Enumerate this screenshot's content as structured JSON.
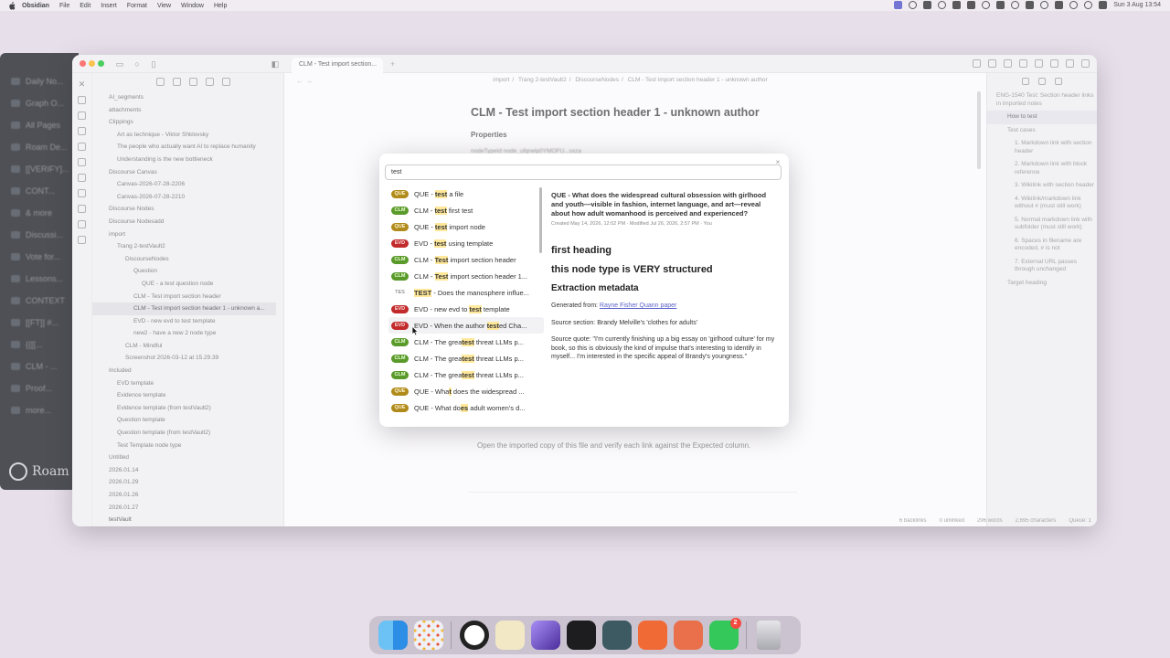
{
  "menubar": {
    "app": "Obsidian",
    "items": [
      "File",
      "Edit",
      "Insert",
      "Format",
      "View",
      "Window",
      "Help"
    ],
    "clock": "Sun 3 Aug  13:54"
  },
  "roam": {
    "items": [
      "Daily No...",
      "Graph O...",
      "All Pages",
      "Roam De...",
      "[[VERIFY]...",
      "CONT...",
      "& more",
      "Discussi...",
      "Vote for...",
      "Lessons...",
      "CONTEXT",
      "[[FT]] #...",
      "{{[[...",
      "CLM - ...",
      "Proof...",
      "more..."
    ],
    "logo": "Roam"
  },
  "window": {
    "tab_title": "CLM - Test import section...",
    "breadcrumb": [
      "import",
      "Trang 2-testVault2",
      "DiscourseNodes",
      "CLM - Test import section header 1 - unknown author"
    ],
    "title": "CLM - Test import section header 1 - unknown author",
    "properties_label": "Properties",
    "prop_row": "nodeTypeId     node_ufqnelp0YMOFU...sxza",
    "body_line": "Open the imported copy of this file and verify each link against the Expected column.",
    "vault_name": "testVault",
    "status": [
      "6 backlinks",
      "0 unlinked",
      "296 words",
      "2,695 characters",
      "Queue: 1"
    ]
  },
  "tree": [
    {
      "label": "AI_segments",
      "indent": 0
    },
    {
      "label": "attachments",
      "indent": 0
    },
    {
      "label": "Clippings",
      "indent": 0
    },
    {
      "label": "Art as technique - Viktor Shklovsky",
      "indent": 1
    },
    {
      "label": "The people who actually want AI to replace humanity",
      "indent": 1
    },
    {
      "label": "Understanding is the new bottleneck",
      "indent": 1
    },
    {
      "label": "Discourse Canvas",
      "indent": 0
    },
    {
      "label": "Canvas-2026-07-28-2206",
      "indent": 1
    },
    {
      "label": "Canvas-2026-07-28-2210",
      "indent": 1
    },
    {
      "label": "Discourse Nodes",
      "indent": 0
    },
    {
      "label": "Discourse Nodesadd",
      "indent": 0
    },
    {
      "label": "import",
      "indent": 0
    },
    {
      "label": "Trang 2-testVault2",
      "indent": 1
    },
    {
      "label": "DiscourseNodes",
      "indent": 2
    },
    {
      "label": "Question",
      "indent": 3
    },
    {
      "label": "QUE - a test question node",
      "indent": 4
    },
    {
      "label": "CLM - Test import section header",
      "indent": 3
    },
    {
      "label": "CLM - Test import section header 1 - unknown a...",
      "indent": 3,
      "selected": true
    },
    {
      "label": "EVD - new evd to test template",
      "indent": 3
    },
    {
      "label": "new2 - have a new 2 node type",
      "indent": 3
    },
    {
      "label": "CLM - Mindful",
      "indent": 2
    },
    {
      "label": "Screenshot 2026-03-12 at 15.29.39",
      "indent": 2
    },
    {
      "label": "Included",
      "indent": 0
    },
    {
      "label": "EVD template",
      "indent": 1
    },
    {
      "label": "Evidence template",
      "indent": 1
    },
    {
      "label": "Evidence template (from testVault2)",
      "indent": 1
    },
    {
      "label": "Question template",
      "indent": 1
    },
    {
      "label": "Question template (from testVault2)",
      "indent": 1
    },
    {
      "label": "Test Template node type",
      "indent": 1
    },
    {
      "label": "Untitled",
      "indent": 0
    },
    {
      "label": "2026.01.14",
      "indent": 0
    },
    {
      "label": "2026.01.29",
      "indent": 0
    },
    {
      "label": "2026.01.26",
      "indent": 0
    },
    {
      "label": "2026.01.27",
      "indent": 0
    }
  ],
  "outline": [
    {
      "label": "ENG-1540 Test: Section header links in imported notes",
      "level": 1
    },
    {
      "label": "How to test",
      "level": 2,
      "current": true
    },
    {
      "label": "Test cases",
      "level": 2
    },
    {
      "label": "1. Markdown link with section header",
      "level": 3
    },
    {
      "label": "2. Markdown link with block reference",
      "level": 3
    },
    {
      "label": "3. Wikilink with section header",
      "level": 3
    },
    {
      "label": "4. Wikilink/markdown link without # (must still work)",
      "level": 3
    },
    {
      "label": "5. Normal markdown link with subfolder (must still work)",
      "level": 3
    },
    {
      "label": "6. Spaces in filename are encoded, # is not",
      "level": 3
    },
    {
      "label": "7. External URL passes through unchanged",
      "level": 3
    },
    {
      "label": "Target heading",
      "level": 2
    }
  ],
  "modal": {
    "query": "test",
    "close": "×",
    "results": [
      {
        "badge": "QUE",
        "pre": "QUE - ",
        "hit": "test",
        "post": " a file"
      },
      {
        "badge": "CLM",
        "pre": "CLM - ",
        "hit": "test",
        "post": " first test"
      },
      {
        "badge": "QUE",
        "pre": "QUE - ",
        "hit": "test",
        "post": " import node"
      },
      {
        "badge": "EVD",
        "pre": "EVD - ",
        "hit": "test",
        "post": " using template"
      },
      {
        "badge": "CLM",
        "pre": "CLM - ",
        "hit": "Test",
        "post": " import section header"
      },
      {
        "badge": "CLM",
        "pre": "CLM - ",
        "hit": "Test",
        "post": " import section header 1..."
      },
      {
        "badge": "TES",
        "pre": "",
        "hit": "TEST",
        "post": " - Does the manosphere influe..."
      },
      {
        "badge": "EVD",
        "pre": "EVD - new evd to ",
        "hit": "test",
        "post": " template"
      },
      {
        "badge": "EVD",
        "pre": "EVD - When the author ",
        "hit": "test",
        "post": "ed Cha..."
      },
      {
        "badge": "CLM",
        "pre": "CLM - The grea",
        "hit": "test",
        "post": " threat LLMs p..."
      },
      {
        "badge": "CLM",
        "pre": "CLM - The grea",
        "hit": "test",
        "post": " threat LLMs p..."
      },
      {
        "badge": "CLM",
        "pre": "CLM - The grea",
        "hit": "test",
        "post": " threat LLMs p..."
      },
      {
        "badge": "QUE",
        "pre": "QUE - Wha",
        "hit": "t",
        "post": " does the widespread ..."
      },
      {
        "badge": "QUE",
        "pre": "QUE - What do",
        "hit": "es",
        "post": " adult women's d..."
      }
    ],
    "preview": {
      "title": "QUE - What does the widespread cultural obsession with girlhood and youth—visible in fashion, internet language, and art—reveal about how adult womanhood is perceived and experienced?",
      "meta": "Created May 14, 2026, 12:02 PM · Modified Jul 26, 2026, 2:57 PM · You",
      "h1": "first heading",
      "h2": "this node type is VERY structured",
      "h3": "Extraction metadata",
      "generated_label": "Generated from: ",
      "generated_link": "Rayne Fisher Quann paper",
      "source_section": "Source section: Brandy Melville's 'clothes for adults'",
      "source_quote": "Source quote: \"I'm currently finishing up a big essay on 'girlhood culture' for my book, so this is obviously the kind of impulse that's interesting to identify in myself... I'm interested in the specific appeal of Brandy's youngness.\""
    }
  },
  "dock": {
    "apps": [
      "finder-icon",
      "launchpad-icon",
      "chrome-icon",
      "keynote-icon",
      "obsidian-icon",
      "cursor-app-icon",
      "roam-icon",
      "claude-icon",
      "figma-icon",
      "messages-icon",
      "trash-icon"
    ],
    "messages_badge": "2"
  },
  "colors": {
    "que": "#b08a1a",
    "clm": "#5a9a2a",
    "evd": "#c22b2b",
    "link": "#5b63c9"
  }
}
